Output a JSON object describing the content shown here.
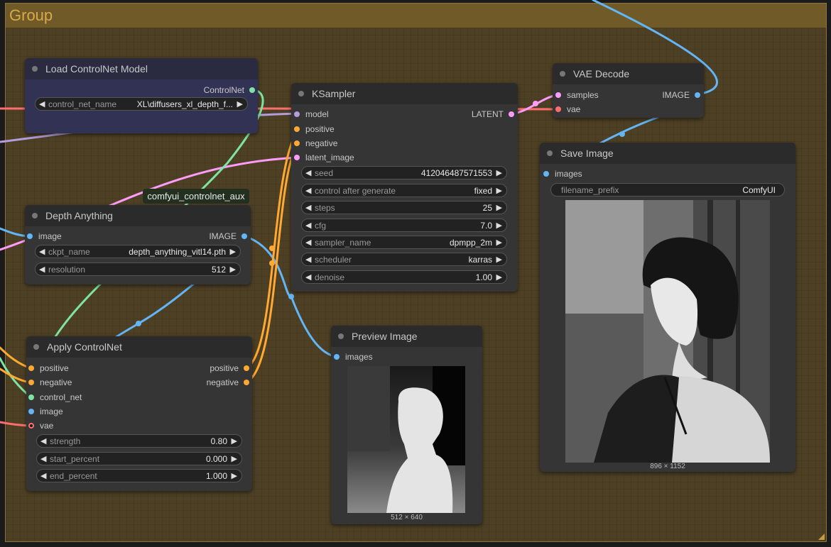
{
  "group": {
    "title": "Group"
  },
  "colors": {
    "model": "#b39ddb",
    "conditioning": "#ffa931",
    "latent": "#ff9cf9",
    "image": "#64b5f6",
    "vae": "#ff6e6e",
    "control_net": "#7ee4a4",
    "group_bg": "#4d4025",
    "group_header": "#6f5a28"
  },
  "badge": {
    "text": "comfyui_controlnet_aux"
  },
  "load_controlnet": {
    "title": "Load ControlNet Model",
    "outputs": [
      "ControlNet"
    ],
    "widgets": [
      {
        "label": "control_net_name",
        "value": "XL\\diffusers_xl_depth_f..."
      }
    ]
  },
  "ksampler": {
    "title": "KSampler",
    "inputs": [
      "model",
      "positive",
      "negative",
      "latent_image"
    ],
    "outputs": [
      "LATENT"
    ],
    "widgets": [
      {
        "label": "seed",
        "value": "412046487571553"
      },
      {
        "label": "control after generate",
        "value": "fixed"
      },
      {
        "label": "steps",
        "value": "25"
      },
      {
        "label": "cfg",
        "value": "7.0"
      },
      {
        "label": "sampler_name",
        "value": "dpmpp_2m"
      },
      {
        "label": "scheduler",
        "value": "karras"
      },
      {
        "label": "denoise",
        "value": "1.00"
      }
    ]
  },
  "vae_decode": {
    "title": "VAE Decode",
    "inputs": [
      "samples",
      "vae"
    ],
    "outputs": [
      "IMAGE"
    ]
  },
  "save_image": {
    "title": "Save Image",
    "inputs": [
      "images"
    ],
    "widgets": [
      {
        "label": "filename_prefix",
        "value": "ComfyUI"
      }
    ],
    "image_size": "896 × 1152"
  },
  "depth_anything": {
    "title": "Depth Anything",
    "inputs": [
      "image"
    ],
    "outputs": [
      "IMAGE"
    ],
    "widgets": [
      {
        "label": "ckpt_name",
        "value": "depth_anything_vitl14.pth"
      },
      {
        "label": "resolution",
        "value": "512"
      }
    ]
  },
  "apply_controlnet": {
    "title": "Apply ControlNet",
    "inputs": [
      "positive",
      "negative",
      "control_net",
      "image",
      "vae"
    ],
    "outputs": [
      "positive",
      "negative"
    ],
    "widgets": [
      {
        "label": "strength",
        "value": "0.80"
      },
      {
        "label": "start_percent",
        "value": "0.000"
      },
      {
        "label": "end_percent",
        "value": "1.000"
      }
    ]
  },
  "preview_image": {
    "title": "Preview Image",
    "inputs": [
      "images"
    ],
    "image_size": "512 × 640"
  },
  "icons": {
    "left_arrow": "◀",
    "right_arrow": "▶"
  }
}
